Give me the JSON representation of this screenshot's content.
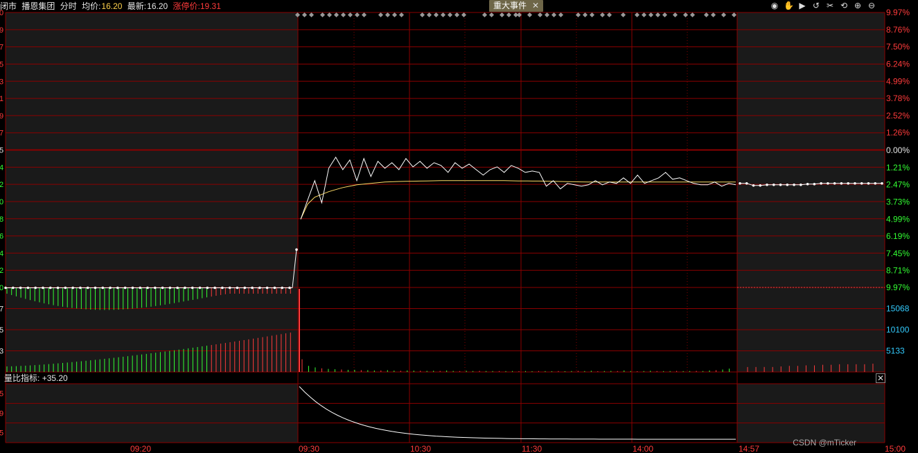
{
  "header": {
    "status": "闭市",
    "stock_name": "播恩集团",
    "mode": "分时",
    "avg_label": "均价:",
    "avg_value": "16.20",
    "latest_label": "最新:",
    "latest_value": "16.20",
    "limit_up_label": "涨停价:",
    "limit_up_value": "19.31"
  },
  "event_tag": {
    "label": "重大事件",
    "close": "✕"
  },
  "toolbar_icons": [
    "eye-icon",
    "hand-icon",
    "play-icon",
    "undo-icon",
    "scissors-icon",
    "refresh-icon",
    "zoom-in-icon",
    "zoom-out-icon"
  ],
  "toolbar_glyphs": [
    "◉",
    "✋",
    "▶",
    "↺",
    "✂",
    "⟲",
    "⊕",
    "⊖"
  ],
  "sub_indicator": {
    "label": "量比指标:",
    "value": "+35.20",
    "close": "✕"
  },
  "watermark": "CSDN @mTicker",
  "colors": {
    "up": "#ff3b3b",
    "down": "#33ff33",
    "grid": "#8b0000",
    "price_line": "#ffffff",
    "avg_line": "#ffdd66",
    "volume_label": "#33ccff",
    "shade": "#1a1a1a"
  },
  "chart_data": {
    "type": "line",
    "x_ticks": [
      "09:20",
      "09:30",
      "10:30",
      "11:30",
      "14:00",
      "14:57",
      "15:00"
    ],
    "price_pct_ticks_up": [
      "9.97%",
      "8.76%",
      "7.50%",
      "6.24%",
      "4.99%",
      "3.78%",
      "2.52%",
      "1.26%"
    ],
    "zero_pct": "0.00%",
    "price_pct_ticks_down": [
      "1.21%",
      "2.47%",
      "3.73%",
      "4.99%",
      "6.19%",
      "7.45%",
      "8.71%",
      "9.97%"
    ],
    "price_left_ticks": [
      "0",
      "9",
      "7",
      "5",
      "3",
      "1",
      "9",
      "7",
      "5",
      "4",
      "2",
      "0",
      "8",
      "6",
      "4",
      "2",
      "0"
    ],
    "volume_ticks": [
      "15068",
      "10100",
      "5133"
    ],
    "volume_left_ticks": [
      "7",
      "5",
      "3"
    ],
    "sub_left_ticks": [
      "5",
      "9",
      "5"
    ],
    "price_pct_range": [
      -9.97,
      9.97
    ],
    "preopen_price_pct": -9.97,
    "series": [
      {
        "values_pct": [
          -5.0,
          -3.6,
          -2.2,
          -3.8,
          -1.3,
          -0.5,
          -1.4,
          -0.7,
          -2.2,
          -0.6,
          -1.9,
          -0.8,
          -1.3,
          -0.9,
          -1.4,
          -0.6,
          -1.2,
          -0.8,
          -1.3,
          -0.9,
          -1.1,
          -1.6,
          -0.9,
          -1.3,
          -1.0,
          -1.4,
          -1.8,
          -1.4,
          -1.2,
          -1.6,
          -1.1,
          -1.3,
          -1.6,
          -1.5,
          -1.6,
          -2.6,
          -2.2,
          -2.8,
          -2.4,
          -2.5,
          -2.6,
          -2.5,
          -2.2,
          -2.5,
          -2.3,
          -2.4,
          -2.0,
          -2.4,
          -1.8,
          -2.4,
          -2.2,
          -2.0,
          -1.6,
          -2.1,
          -2.0,
          -2.2,
          -2.4,
          -2.5,
          -2.5,
          -2.3,
          -2.6,
          -2.4,
          -2.5
        ]
      },
      {
        "values_pct": [
          -5.0,
          -3.9,
          -3.4,
          -3.2,
          -3.0,
          -2.85,
          -2.7,
          -2.6,
          -2.5,
          -2.45,
          -2.4,
          -2.35,
          -2.3,
          -2.28,
          -2.26,
          -2.25,
          -2.24,
          -2.23,
          -2.22,
          -2.21,
          -2.2,
          -2.2,
          -2.2,
          -2.2,
          -2.2,
          -2.2,
          -2.2,
          -2.2,
          -2.2,
          -2.2,
          -2.21,
          -2.22,
          -2.22,
          -2.23,
          -2.23,
          -2.24,
          -2.25,
          -2.26,
          -2.27,
          -2.28,
          -2.29,
          -2.3,
          -2.3,
          -2.3,
          -2.3,
          -2.3,
          -2.3,
          -2.3,
          -2.3,
          -2.3,
          -2.3,
          -2.3,
          -2.3,
          -2.3,
          -2.3,
          -2.3,
          -2.3,
          -2.3,
          -2.3,
          -2.3,
          -2.3,
          -2.3,
          -2.3
        ]
      }
    ],
    "post_close_pct": [
      -2.4,
      -2.4,
      -2.55,
      -2.55,
      -2.5,
      -2.5,
      -2.5,
      -2.5,
      -2.5,
      -2.5,
      -2.45,
      -2.45,
      -2.4,
      -2.4,
      -2.4,
      -2.4,
      -2.4,
      -2.4,
      -2.4,
      -2.4,
      -2.4,
      -2.4
    ],
    "volume": {
      "max": 15068,
      "spike": 15068,
      "continuous": [
        4200,
        2000,
        1500,
        1200,
        1000,
        900,
        800,
        700,
        700,
        600,
        600,
        500,
        500,
        600,
        450,
        400,
        500,
        450,
        400,
        350,
        400,
        350,
        500,
        350,
        300,
        400,
        300,
        350,
        300,
        300,
        300,
        280,
        300,
        260,
        300,
        250,
        300,
        280,
        250,
        300,
        250,
        300,
        350,
        300,
        400,
        250,
        300,
        350,
        300,
        500,
        300,
        250,
        300,
        400,
        300,
        280,
        300,
        350,
        280,
        300,
        350,
        300,
        500,
        600,
        800,
        1100
      ],
      "post_close": [
        900,
        900,
        900,
        900,
        1000,
        1100,
        1100,
        1200,
        1200,
        1300,
        1300,
        1400,
        1400,
        1400,
        1400,
        1500
      ]
    },
    "volume_ratio": {
      "current": 35.2,
      "start": 35.2,
      "end": 0.4
    }
  }
}
